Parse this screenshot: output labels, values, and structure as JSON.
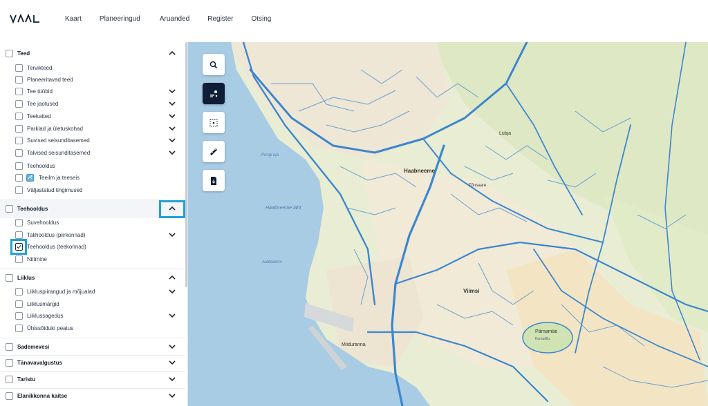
{
  "header": {
    "logo": "VAAL",
    "nav": [
      "Kaart",
      "Planeeringud",
      "Aruanded",
      "Register",
      "Otsing"
    ]
  },
  "sidebar": {
    "groups": [
      {
        "title": "Teed",
        "items": [
          "Tervikteed",
          "Planeeritavad teed",
          "Tee tüübid",
          "Tee jaotused",
          "Teekatted",
          "Parklad ja ületuskohad",
          "Suvised seisunditasemed",
          "Talvised seisunditasemed",
          "Teehooldus",
          "Teeilm ja teeseis",
          "Väljastatud tingimused"
        ]
      },
      {
        "title": "Teehooldus",
        "items": [
          "Suvehooldus",
          "Talihooldus (piirkonnad)",
          "Teehooldus (teekonnad)",
          "Niitmine"
        ]
      },
      {
        "title": "Liiklus",
        "items": [
          "Liikluspiirangud ja mõjualad",
          "Liiklusmärgid",
          "Liiklussagedus",
          "Ühissõiduki peatus"
        ]
      },
      {
        "title": "Sademevesi"
      },
      {
        "title": "Tänavavalgustus"
      },
      {
        "title": "Taristu"
      },
      {
        "title": "Elanikkonna kaitse"
      }
    ]
  },
  "map": {
    "places": [
      "Haabneeme",
      "Viimsi",
      "Lubja",
      "Pärnamäe",
      "Miiduranna",
      "Tõnsaare",
      "Pringi oja",
      "Haabneeme laht",
      "Aiaddamm",
      "Kurepõllu"
    ],
    "tools": [
      "search-icon",
      "layers-icon",
      "select-area-icon",
      "ruler-icon",
      "export-icon"
    ]
  },
  "colors": {
    "accent": "#1fa2d8",
    "road": "#3b86cf",
    "water": "#a9cce5",
    "tool_active": "#0f1d36"
  }
}
